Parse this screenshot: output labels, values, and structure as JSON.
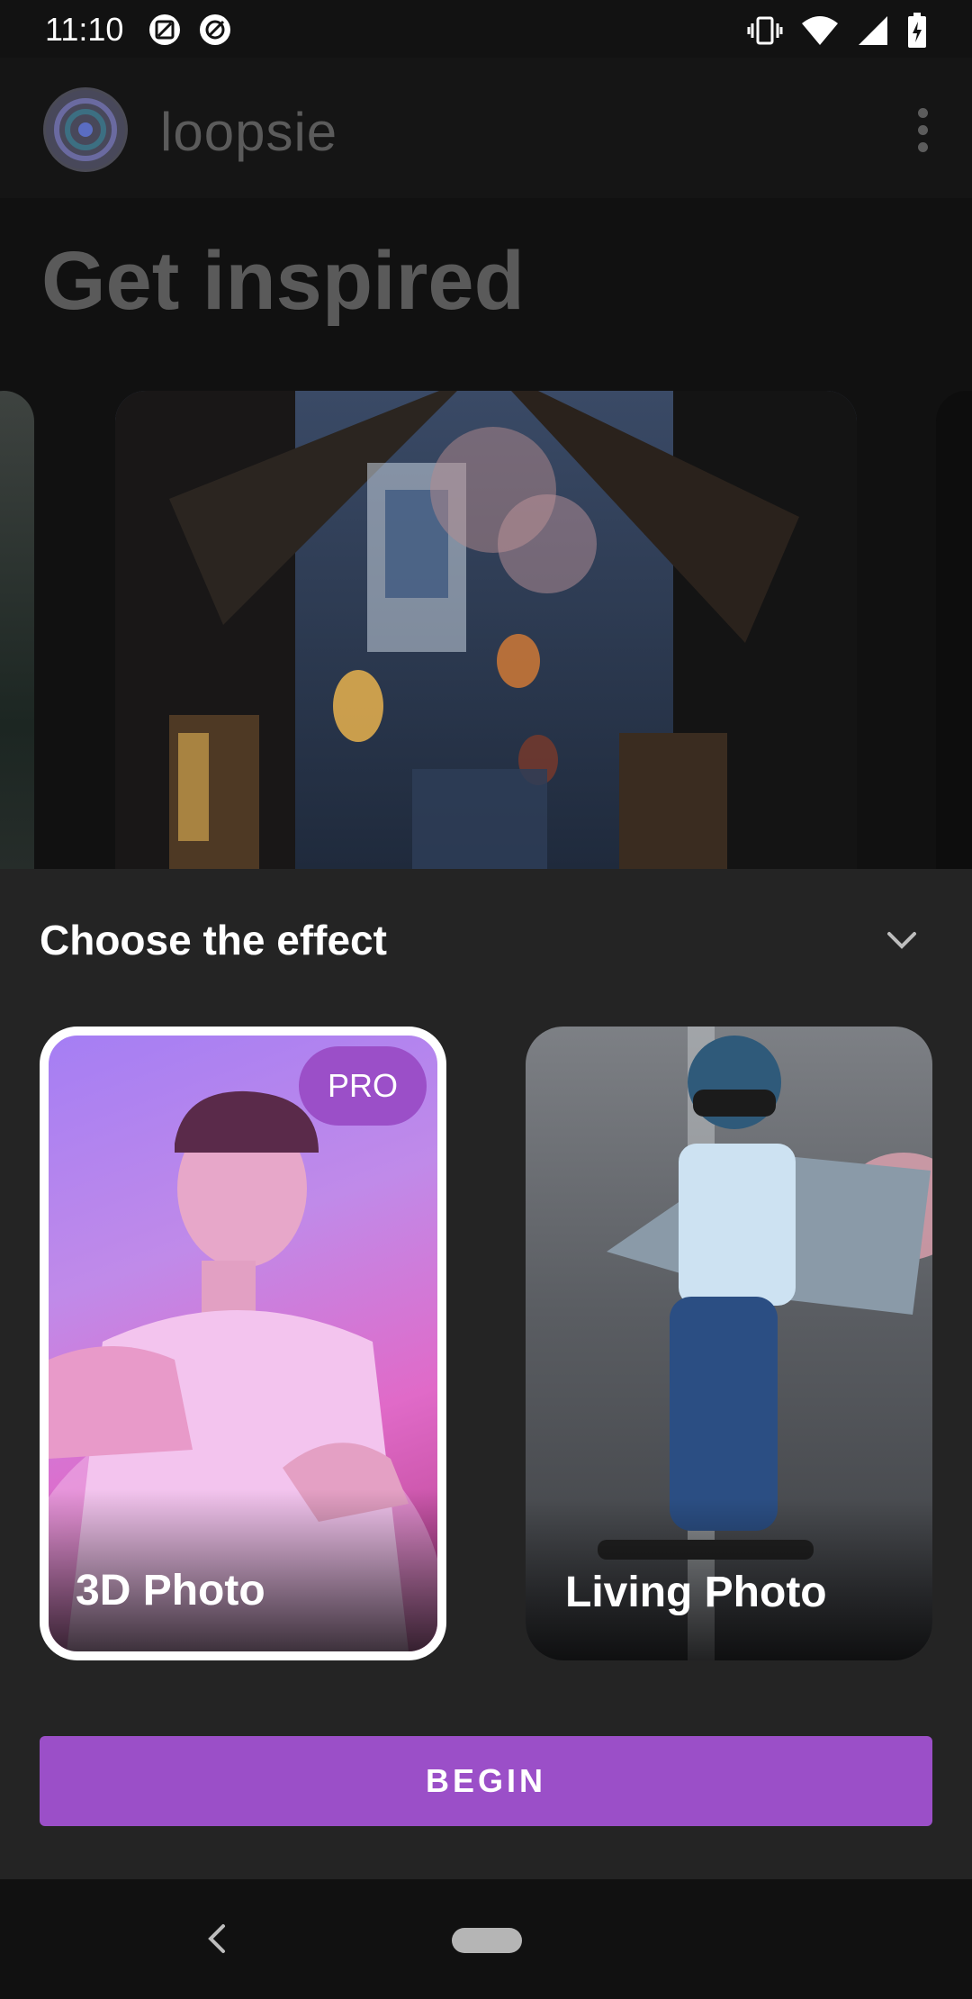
{
  "status_bar": {
    "time": "11:10",
    "left_icons": [
      "screenshot-icon",
      "data-saver-icon"
    ],
    "right_icons": [
      "vibrate-icon",
      "wifi-icon",
      "signal-icon",
      "battery-charging-icon"
    ]
  },
  "app_bar": {
    "app_name": "loopsie",
    "logo_icon": "loopsie-logo-icon",
    "menu_icon": "more-vert-icon"
  },
  "main": {
    "heading": "Get inspired",
    "carousel": {
      "items": [
        "photo-left-partial",
        "street-lanterns-photo",
        "photo-right-partial"
      ]
    }
  },
  "sheet": {
    "title": "Choose the effect",
    "collapse_icon": "chevron-down-icon",
    "cards": [
      {
        "label": "3D Photo",
        "badge": "PRO",
        "selected": true
      },
      {
        "label": "Living Photo",
        "badge": "",
        "selected": false
      }
    ],
    "button_label": "BEGIN"
  },
  "nav_bar": {
    "back_icon": "back-icon",
    "home_icon": "home-pill-icon"
  },
  "colors": {
    "accent": "#9b4fc8",
    "sheet_bg": "#242424",
    "app_bg": "#111111"
  }
}
